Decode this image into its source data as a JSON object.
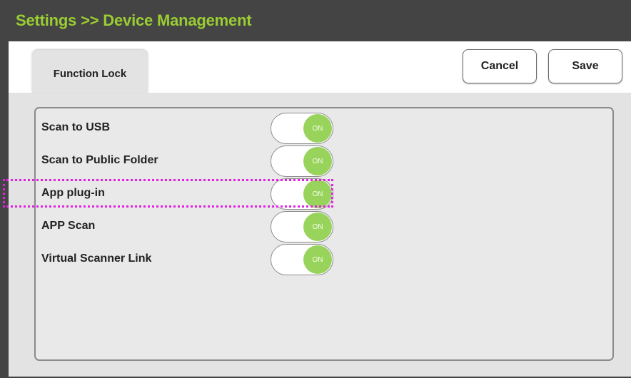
{
  "title_bar": {
    "title": "Settings >> Device Management",
    "title_color": "#9acd32"
  },
  "tabs": [
    {
      "label": "Function Lock",
      "active": true
    }
  ],
  "toolbar": {
    "cancel_label": "Cancel",
    "save_label": "Save"
  },
  "settings": [
    {
      "label": "Scan to USB",
      "state": "ON"
    },
    {
      "label": "Scan to Public Folder",
      "state": "ON"
    },
    {
      "label": "App plug-in",
      "state": "ON",
      "highlighted": true
    },
    {
      "label": "APP Scan",
      "state": "ON"
    },
    {
      "label": "Virtual Scanner Link",
      "state": "ON"
    }
  ],
  "colors": {
    "toggle_on": "#98d45c",
    "highlight": "#e520e5",
    "background_dark": "#444444"
  }
}
